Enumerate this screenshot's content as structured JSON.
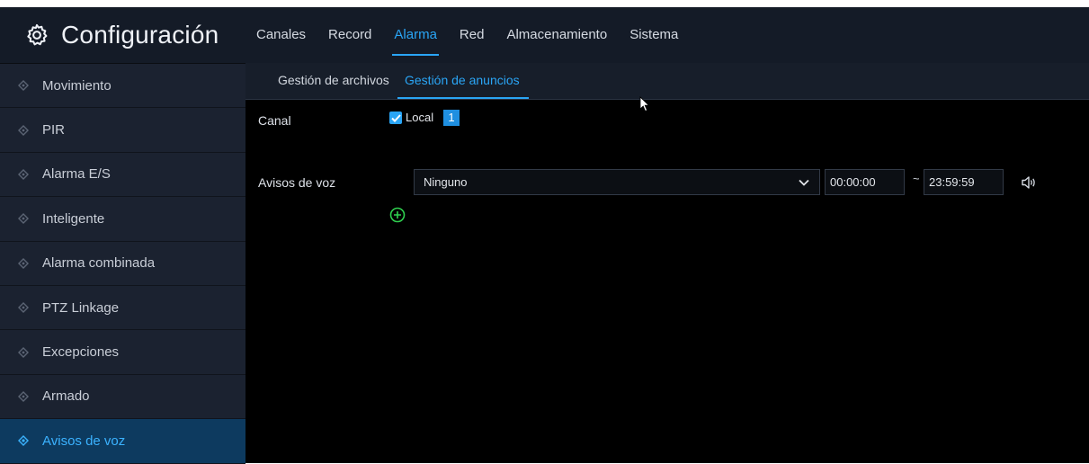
{
  "header": {
    "title": "Configuración",
    "tabs": [
      {
        "label": "Canales"
      },
      {
        "label": "Record"
      },
      {
        "label": "Alarma",
        "active": true
      },
      {
        "label": "Red"
      },
      {
        "label": "Almacenamiento"
      },
      {
        "label": "Sistema"
      }
    ]
  },
  "sidebar": {
    "items": [
      {
        "label": "Movimiento"
      },
      {
        "label": "PIR"
      },
      {
        "label": "Alarma E/S"
      },
      {
        "label": "Inteligente"
      },
      {
        "label": "Alarma combinada"
      },
      {
        "label": "PTZ Linkage"
      },
      {
        "label": "Excepciones"
      },
      {
        "label": "Armado"
      },
      {
        "label": "Avisos de voz",
        "active": true
      }
    ]
  },
  "subtabs": [
    {
      "label": "Gestión de archivos"
    },
    {
      "label": "Gestión de anuncios",
      "active": true
    }
  ],
  "form": {
    "canal_label": "Canal",
    "local_label": "Local",
    "local_checked": true,
    "channel_number": "1",
    "avisos_label": "Avisos de voz",
    "select_value": "Ninguno",
    "start_time": "00:00:00",
    "tilde": "~",
    "end_time": "23:59:59"
  },
  "icons": {
    "brand": "gear-icon",
    "sidebar_bullet": "diamond-icon",
    "select_arrow": "chevron-down-icon",
    "speaker": "speaker-icon",
    "add": "add-circle-icon",
    "cursor": "mouse-cursor-icon"
  },
  "colors": {
    "accent": "#2aa5f5",
    "header_bg": "#141b27",
    "sidebar_bg": "#1b2230",
    "sidebar_active_bg": "#0d3a5f",
    "add_icon": "#2fd14f"
  }
}
